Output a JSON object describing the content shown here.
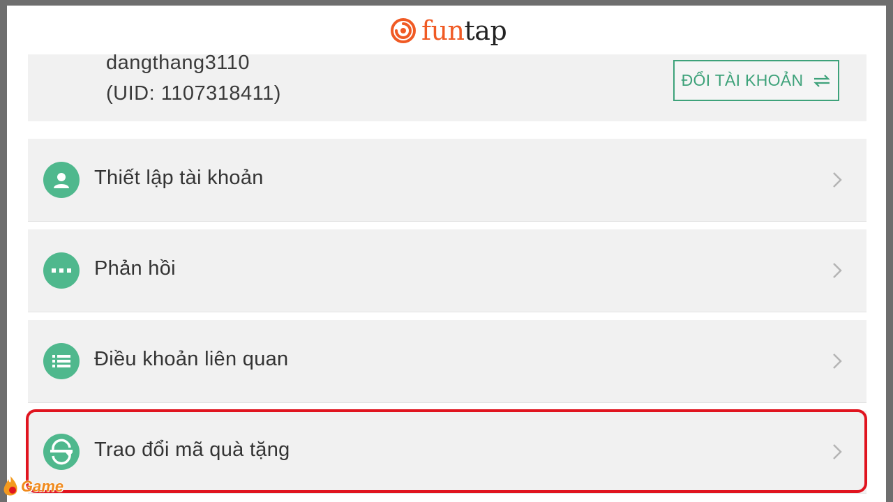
{
  "brand": {
    "part1": "fun",
    "part2": "tap"
  },
  "account": {
    "username": "dangthang3110",
    "uid": "(UID: 1107318411)",
    "switch_label": "ĐỔI TÀI KHOẢN"
  },
  "menu": {
    "items": [
      {
        "label": "Thiết lập tài khoản",
        "icon": "user-icon"
      },
      {
        "label": "Phản hồi",
        "icon": "chat-dots-icon"
      },
      {
        "label": "Điều khoản liên quan",
        "icon": "list-icon"
      },
      {
        "label": "Trao đổi mã quà tặng",
        "icon": "exchange-icon"
      }
    ]
  },
  "watermark": {
    "text": "Game"
  },
  "colors": {
    "accent": "#4fb88d",
    "brand_orange": "#f05a24",
    "highlight": "#e0141f",
    "card_bg": "#f1f1f1"
  }
}
